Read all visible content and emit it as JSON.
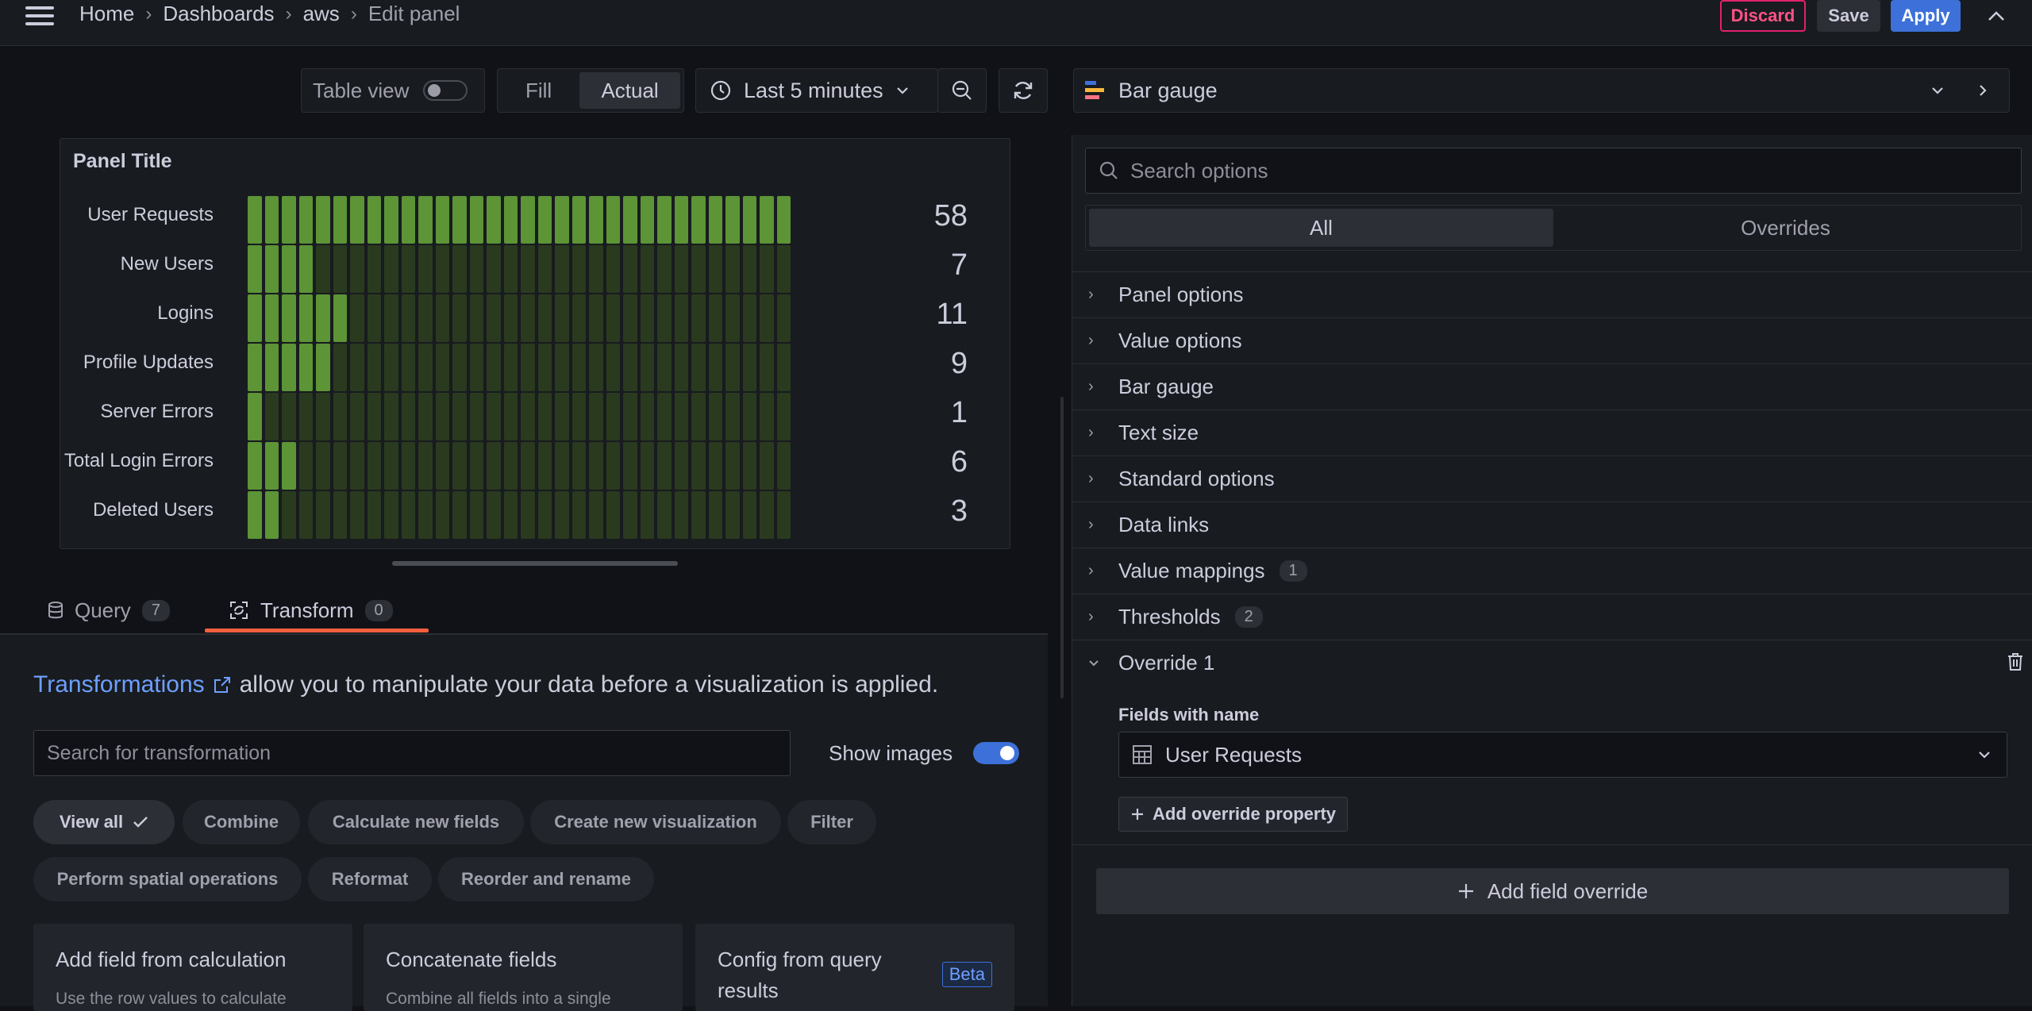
{
  "breadcrumb": {
    "home": "Home",
    "dashboards": "Dashboards",
    "folder": "aws",
    "current": "Edit panel"
  },
  "header_actions": {
    "discard": "Discard",
    "save": "Save",
    "apply": "Apply"
  },
  "toolbar": {
    "table_view_label": "Table view",
    "table_view_on": false,
    "fill_label": "Fill",
    "actual_label": "Actual",
    "time_range": "Last 5 minutes"
  },
  "visualization": {
    "selected": "Bar gauge"
  },
  "panel": {
    "title": "Panel Title",
    "max_cells": 32,
    "bars": [
      {
        "label": "User Requests",
        "value": "58",
        "lit": 32
      },
      {
        "label": "New Users",
        "value": "7",
        "lit": 4
      },
      {
        "label": "Logins",
        "value": "11",
        "lit": 6
      },
      {
        "label": "Profile Updates",
        "value": "9",
        "lit": 5
      },
      {
        "label": "Server Errors",
        "value": "1",
        "lit": 1
      },
      {
        "label": "Total Login Errors",
        "value": "6",
        "lit": 3
      },
      {
        "label": "Deleted Users",
        "value": "3",
        "lit": 2
      }
    ],
    "colors": {
      "lit": "#5c9436",
      "unlit": "#2a3a1f"
    }
  },
  "tabs": {
    "query": {
      "label": "Query",
      "count": "7"
    },
    "transform": {
      "label": "Transform",
      "count": "0"
    }
  },
  "transform": {
    "intro_link": "Transformations",
    "intro_text": "allow you to manipulate your data before a visualization is applied.",
    "search_placeholder": "Search for transformation",
    "show_images_label": "Show images",
    "chips": [
      "View all",
      "Combine",
      "Calculate new fields",
      "Create new visualization",
      "Filter",
      "Perform spatial operations",
      "Reformat",
      "Reorder and rename"
    ],
    "cards": [
      {
        "title": "Add field from calculation",
        "desc": "Use the row values to calculate"
      },
      {
        "title": "Concatenate fields",
        "desc": "Combine all fields into a single"
      },
      {
        "title": "Config from query results",
        "badge": "Beta"
      }
    ]
  },
  "options": {
    "search_placeholder": "Search options",
    "seg_all": "All",
    "seg_overrides": "Overrides",
    "sections": [
      {
        "label": "Panel options"
      },
      {
        "label": "Value options"
      },
      {
        "label": "Bar gauge"
      },
      {
        "label": "Text size"
      },
      {
        "label": "Standard options"
      },
      {
        "label": "Data links"
      },
      {
        "label": "Value mappings",
        "badge": "1"
      },
      {
        "label": "Thresholds",
        "badge": "2"
      },
      {
        "label": "Override 1"
      }
    ],
    "override": {
      "matcher_label": "Fields with name",
      "matcher_value": "User Requests",
      "add_property": "Add override property"
    },
    "add_field_override": "Add field override"
  }
}
